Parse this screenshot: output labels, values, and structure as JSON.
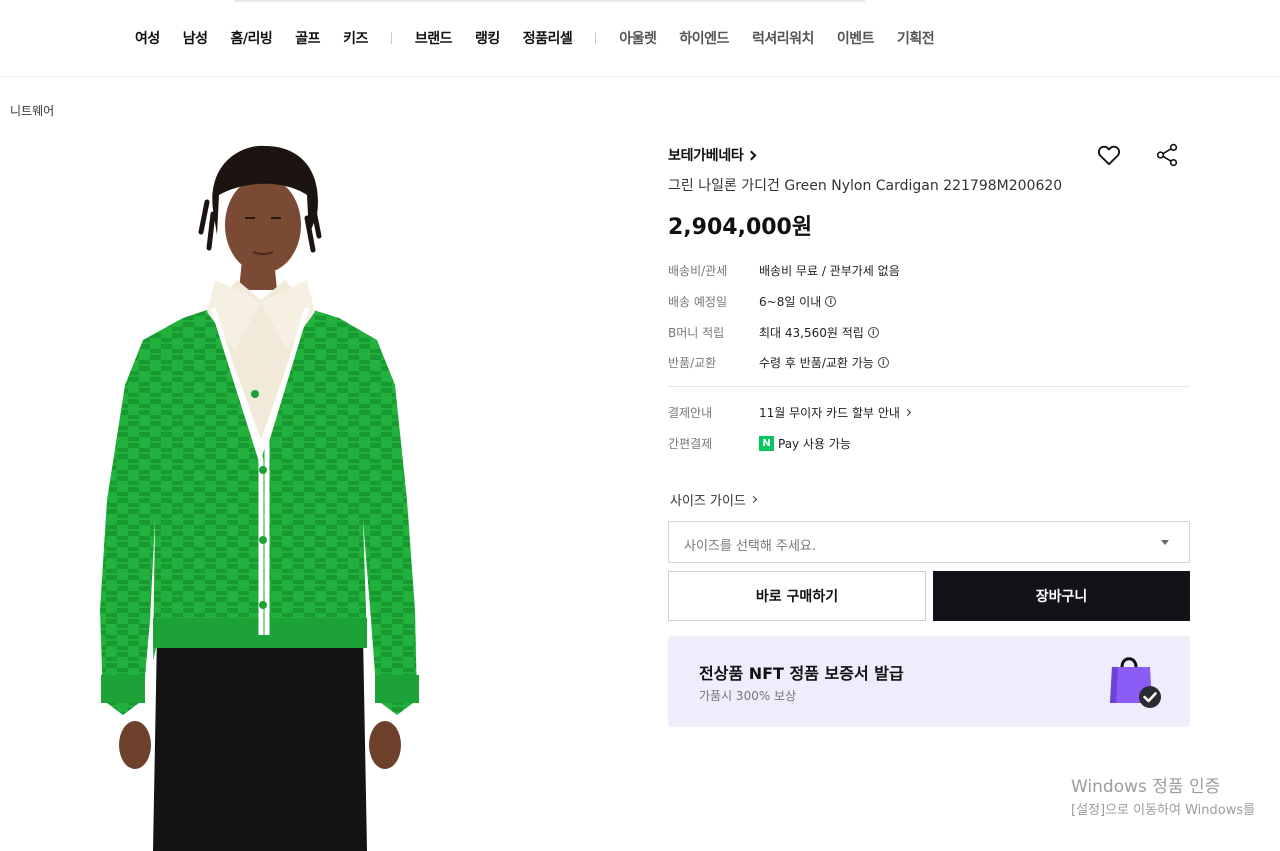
{
  "nav": {
    "items": [
      {
        "label": "여성",
        "dim": false
      },
      {
        "label": "남성",
        "dim": false
      },
      {
        "label": "홈/리빙",
        "dim": false
      },
      {
        "label": "골프",
        "dim": false
      },
      {
        "label": "키즈",
        "dim": false
      },
      {
        "separator": true
      },
      {
        "label": "브랜드",
        "dim": false
      },
      {
        "label": "랭킹",
        "dim": false
      },
      {
        "label": "정품리셀",
        "dim": false
      },
      {
        "separator": true
      },
      {
        "label": "아울렛",
        "dim": true
      },
      {
        "label": "하이엔드",
        "dim": true
      },
      {
        "label": "럭셔리워치",
        "dim": true
      },
      {
        "label": "이벤트",
        "dim": true
      },
      {
        "label": "기획전",
        "dim": true
      }
    ]
  },
  "breadcrumb": "니트웨어",
  "product": {
    "brand": "보테가베네타",
    "name": "그린 나일론 가디건 Green Nylon Cardigan 221798M200620",
    "price": "2,904,000원",
    "image_icon": "product-photo-green-cardigan",
    "details": [
      {
        "key": "배송비/관세",
        "value": "배송비 무료 / 관부가세 없음",
        "info": false,
        "chevron": false
      },
      {
        "key": "배송 예정일",
        "value": "6~8일 이내",
        "info": true,
        "chevron": false
      },
      {
        "key": "B머니 적립",
        "value": "최대 43,560원 적립",
        "info": true,
        "chevron": false
      },
      {
        "key": "반품/교환",
        "value": "수령 후 반품/교환 가능",
        "info": true,
        "chevron": false
      }
    ],
    "payments": [
      {
        "key": "결제안내",
        "value": "11월 무이자 카드 할부 안내",
        "chevron": true
      },
      {
        "key": "간편결제",
        "value": "Pay 사용 가능",
        "logo": "N"
      }
    ]
  },
  "size": {
    "guide_label": "사이즈 가이드",
    "placeholder": "사이즈를 선택해 주세요."
  },
  "buttons": {
    "buy_now": "바로 구매하기",
    "cart": "장바구니"
  },
  "nft": {
    "title": "전상품 NFT 정품 보증서 발급",
    "subtitle": "가품시 300% 보상",
    "icon": "shopping-bag-check-icon"
  },
  "icons": {
    "wish": "heart-icon",
    "share": "share-icon"
  },
  "colors": {
    "cardigan_green": "#1fae3a",
    "cart_button": "#111318",
    "nft_banner_bg": "#eeedfb",
    "bag_purple": "#8b5cf6",
    "npay_green": "#03c75a"
  },
  "watermark": {
    "line1": "Windows 정품 인증",
    "line2": "[설정]으로 이동하여 Windows를"
  }
}
